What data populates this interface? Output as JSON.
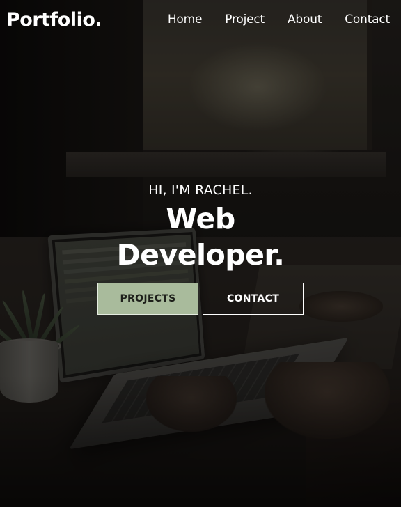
{
  "nav": {
    "brand": "Portfolio.",
    "items": [
      {
        "label": "Home"
      },
      {
        "label": "Project"
      },
      {
        "label": "About"
      },
      {
        "label": "Contact"
      }
    ]
  },
  "hero": {
    "greeting": "HI, I'M RACHEL.",
    "title_line1": "Web",
    "title_line2": "Developer.",
    "buttons": {
      "primary": "PROJECTS",
      "secondary": "CONTACT"
    }
  },
  "colors": {
    "accent": "#a9bb9c",
    "text": "#ffffff",
    "overlay": "#000000"
  }
}
